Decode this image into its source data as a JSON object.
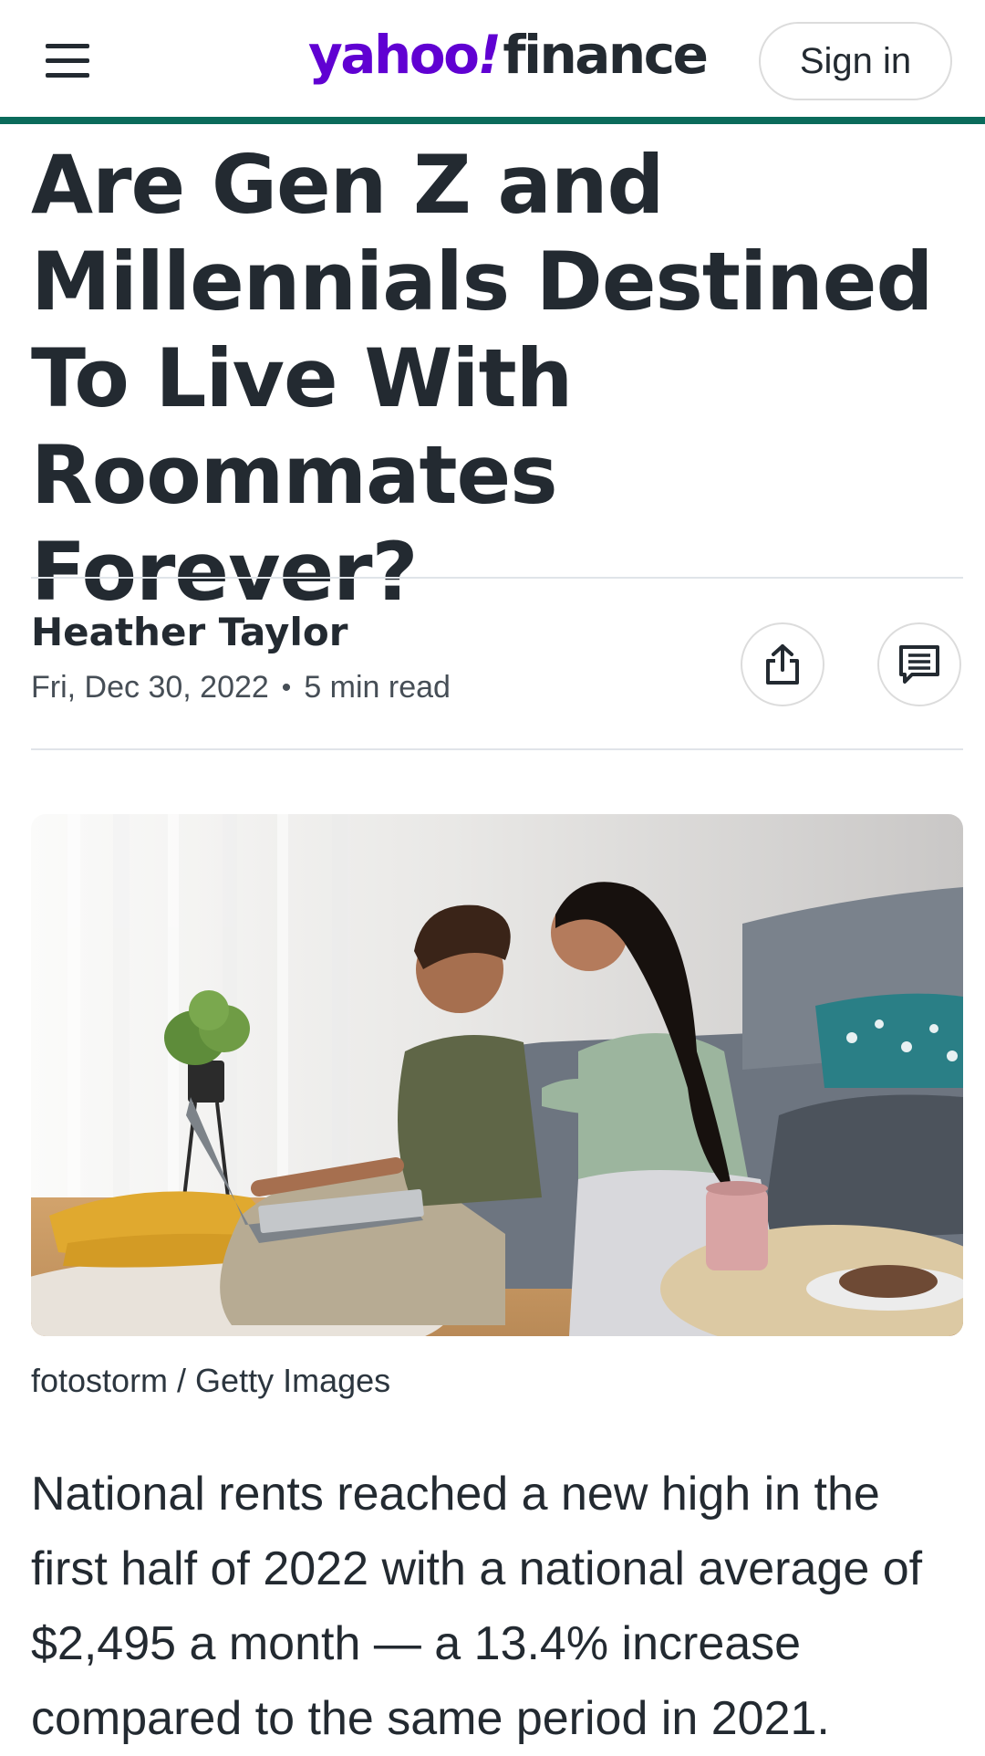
{
  "header": {
    "logo_yahoo": "yahoo",
    "logo_bang": "!",
    "logo_finance": "finance",
    "signin_label": "Sign in",
    "accent_color": "#0a6b5b",
    "brand_color": "#6001d2"
  },
  "article": {
    "title": "Are Gen Z and Millennials Destined To Live With Roommates Forever?",
    "author": "Heather Taylor",
    "date": "Fri, Dec 30, 2022",
    "separator": "•",
    "read_time": "5 min read",
    "share_icon": "share-icon",
    "comment_icon": "comment-icon",
    "image_caption": "fotostorm / Getty Images",
    "body_paragraph": "National rents reached a new high in the first half of 2022 with a national average of $2,495 a month — a 13.4% increase compared to the same period in 2021."
  }
}
